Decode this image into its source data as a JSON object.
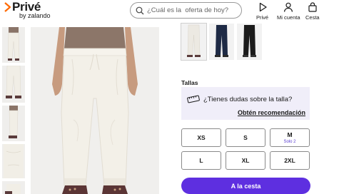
{
  "header": {
    "logo_brand": "Privé",
    "logo_sub": "by zalando",
    "search_placeholder": "¿Cuál es la  oferta de hoy?",
    "nav": [
      {
        "label": "Privé",
        "icon": "play-triangle-icon"
      },
      {
        "label": "Mi cuenta",
        "icon": "user-icon"
      },
      {
        "label": "Cesta",
        "icon": "bag-icon"
      }
    ]
  },
  "gallery": {
    "thumbnails": [
      "trousers-front",
      "trousers-legs",
      "trousers-side",
      "trousers-detail",
      "trousers-cropped"
    ],
    "main_image": "cream-sweatpants-model-front"
  },
  "colors": {
    "swatches": [
      {
        "name": "cream",
        "color": "#ece9e2",
        "selected": true
      },
      {
        "name": "navy",
        "color": "#1e2a45",
        "selected": false
      },
      {
        "name": "black",
        "color": "#1b1b1b",
        "selected": false
      }
    ]
  },
  "sizes": {
    "title": "Tallas",
    "help_text": "¿Tienes dudas sobre la talla?",
    "help_link": "Obtén recomendación",
    "options": [
      {
        "label": "XS",
        "stock": ""
      },
      {
        "label": "S",
        "stock": ""
      },
      {
        "label": "M",
        "stock": "Solo 2"
      },
      {
        "label": "L",
        "stock": ""
      },
      {
        "label": "XL",
        "stock": ""
      },
      {
        "label": "2XL",
        "stock": ""
      }
    ]
  },
  "cart": {
    "add_label": "A la cesta"
  },
  "theme": {
    "accent": "#5e2fe0",
    "help_bg": "#f0eef9"
  }
}
